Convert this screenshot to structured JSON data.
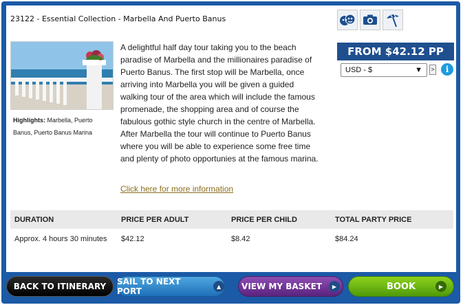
{
  "tour": {
    "title": "23122 - Essential Collection - Marbella And Puerto Banus",
    "highlights_label": "Highlights:",
    "highlights": "Marbella, Puerto Banus, Puerto Banus Marina",
    "description": "A delightful half day tour taking you to the beach paradise of Marbella and the millionaires paradise of Puerto Banus.  The first stop will be Marbella, once arriving into Marbella you will be given a guided walking tour of the area which will include the famous promenade, the shopping area and of course the fabulous gothic style church in the centre of Marbella.  After Marbella the tour will continue to Puerto Banus where you will be able to experience some free time and plenty of photo opportunies at the famous marina.",
    "more_info_link": "Click here for more information"
  },
  "activity_icons": [
    "theatre-masks-icon",
    "camera-icon",
    "beach-umbrella-icon"
  ],
  "pricing": {
    "banner": "FROM $42.12 PP",
    "currency_selected": "USD - $",
    "go_label": ">",
    "info_label": "i"
  },
  "table": {
    "headers": [
      "DURATION",
      "PRICE PER ADULT",
      "PRICE PER CHILD",
      "TOTAL PARTY PRICE"
    ],
    "row": [
      "Approx. 4 hours 30 minutes",
      "$42.12",
      "$8.42",
      "$84.24"
    ]
  },
  "buttons": {
    "back": "BACK TO ITINERARY",
    "sail": "SAIL TO NEXT PORT",
    "basket": "VIEW MY BASKET",
    "book": "BOOK"
  },
  "colors": {
    "frame": "#1b5aa6",
    "price_banner": "#1f4f8f",
    "link": "#8a6d1b",
    "book": "#6db616",
    "basket": "#6e2f97",
    "sail": "#3a8ccf"
  }
}
